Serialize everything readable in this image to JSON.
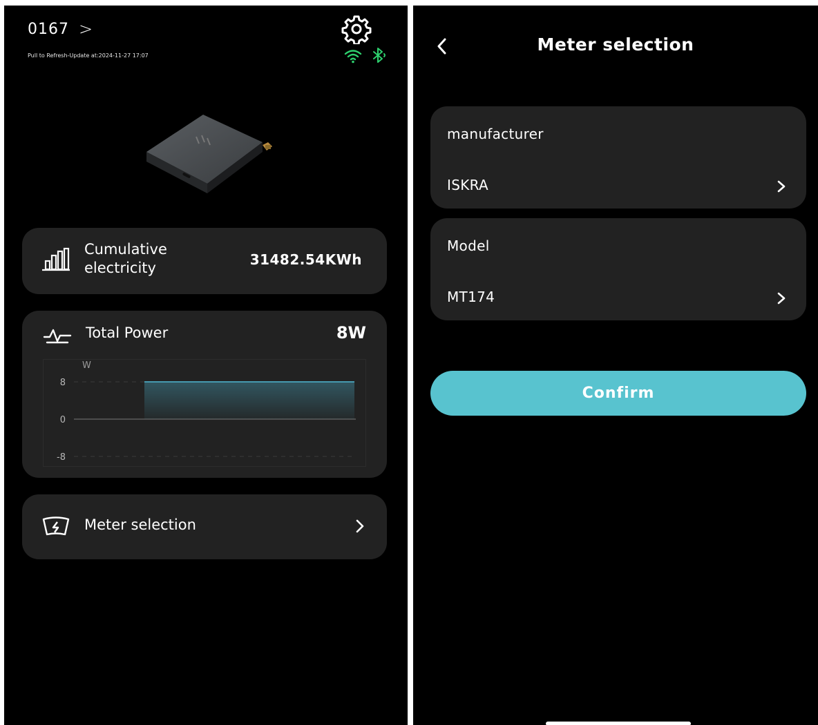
{
  "left": {
    "device_id": "0167",
    "device_chevron": ">",
    "refresh_text": "Pull to Refresh-Update at:2024-11-27 17:07",
    "icons": {
      "settings": "gear-icon",
      "wifi": "wifi-icon",
      "bluetooth": "bluetooth-icon",
      "cumulative": "bar-chart-icon",
      "power": "pulse-icon",
      "meter": "meter-icon"
    },
    "status_color": "#2ed06e",
    "cumulative": {
      "label": "Cumulative electricity",
      "value": "31482.54KWh"
    },
    "power": {
      "label": "Total Power",
      "value": "8W"
    },
    "meter_selection": {
      "label": "Meter selection"
    }
  },
  "chart_data": {
    "type": "area",
    "ylabel": "W",
    "yticks": [
      "8",
      "0",
      "-8"
    ],
    "ylim": [
      -8,
      8
    ],
    "series": [
      {
        "values": [
          8,
          8,
          8,
          8,
          8,
          8,
          8,
          8
        ]
      }
    ],
    "line_color": "#4fb8d4",
    "grid": true
  },
  "right": {
    "title": "Meter selection",
    "manufacturer": {
      "label": "manufacturer",
      "value": "ISKRA"
    },
    "model": {
      "label": "Model",
      "value": "MT174"
    },
    "confirm_label": "Confirm",
    "accent": "#58c3cf"
  }
}
